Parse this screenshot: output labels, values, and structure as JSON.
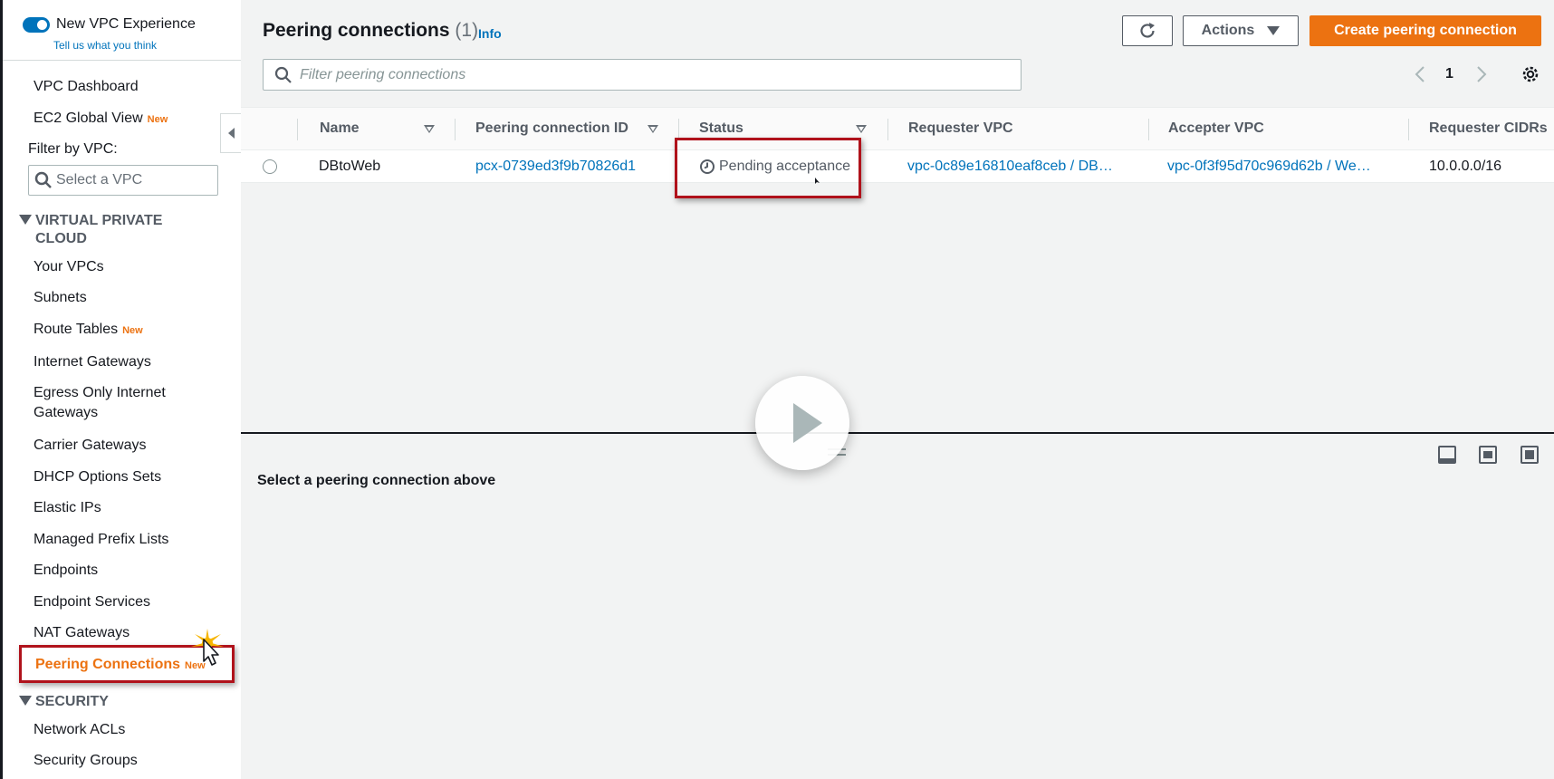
{
  "sidebar": {
    "toggle_label": "New VPC Experience",
    "feedback_link": "Tell us what you think",
    "items_top": [
      {
        "label": "VPC Dashboard",
        "badge": ""
      },
      {
        "label": "EC2 Global View",
        "badge": "New"
      }
    ],
    "filter_label": "Filter by VPC:",
    "filter_placeholder": "Select a VPC",
    "section_vpc_line1": "VIRTUAL PRIVATE",
    "section_vpc_line2": "CLOUD",
    "vpc_items": [
      {
        "label": "Your VPCs",
        "badge": ""
      },
      {
        "label": "Subnets",
        "badge": ""
      },
      {
        "label": "Route Tables",
        "badge": "New"
      },
      {
        "label": "Internet Gateways",
        "badge": ""
      },
      {
        "label": "Egress Only Internet",
        "label2": "Gateways",
        "badge": ""
      },
      {
        "label": "Carrier Gateways",
        "badge": ""
      },
      {
        "label": "DHCP Options Sets",
        "badge": ""
      },
      {
        "label": "Elastic IPs",
        "badge": ""
      },
      {
        "label": "Managed Prefix Lists",
        "badge": ""
      },
      {
        "label": "Endpoints",
        "badge": ""
      },
      {
        "label": "Endpoint Services",
        "badge": ""
      },
      {
        "label": "NAT Gateways",
        "badge": ""
      },
      {
        "label": "Peering Connections",
        "badge": "New"
      }
    ],
    "section_security": "SECURITY",
    "security_items": [
      {
        "label": "Network ACLs"
      },
      {
        "label": "Security Groups"
      }
    ]
  },
  "header": {
    "title": "Peering connections",
    "count": "(1)",
    "info": "Info",
    "actions_label": "Actions",
    "create_label": "Create peering connection"
  },
  "search": {
    "placeholder": "Filter peering connections"
  },
  "pagination": {
    "page": "1"
  },
  "table": {
    "columns": [
      "Name",
      "Peering connection ID",
      "Status",
      "Requester VPC",
      "Accepter VPC",
      "Requester CIDRs"
    ],
    "rows": [
      {
        "name": "DBtoWeb",
        "id": "pcx-0739ed3f9b70826d1",
        "status": "Pending acceptance",
        "requester_vpc": "vpc-0c89e16810eaf8ceb / DB…",
        "accepter_vpc": "vpc-0f3f95d70c969d62b / We…",
        "requester_cidrs": "10.0.0.0/16"
      }
    ]
  },
  "split_panel": {
    "message": "Select a peering connection above"
  },
  "colors": {
    "accent": "#ec7211",
    "link": "#0073bb",
    "highlight": "#b0121b"
  }
}
